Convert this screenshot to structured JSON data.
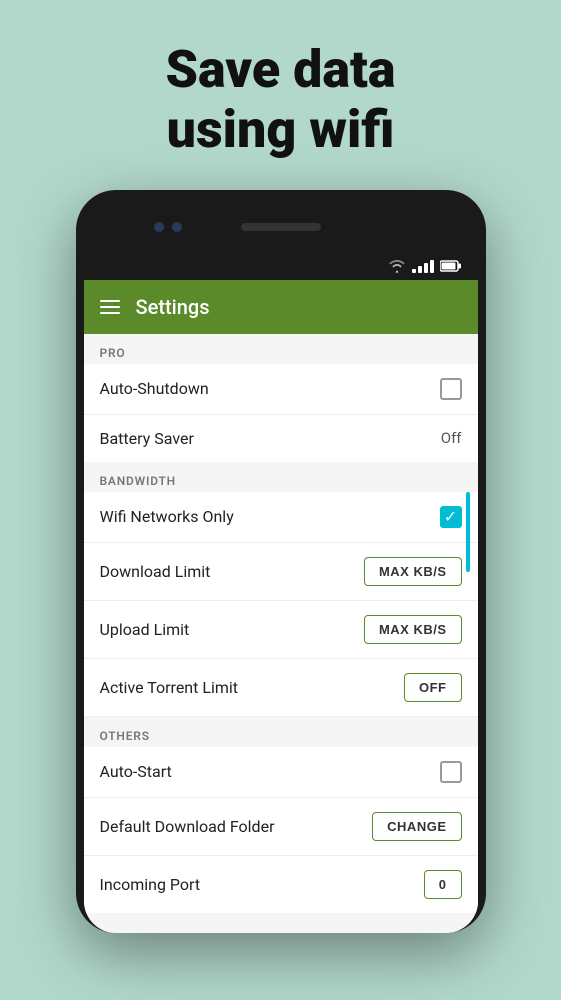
{
  "hero": {
    "title_line1": "Save data",
    "title_line2": "using wifi"
  },
  "appbar": {
    "title": "Settings",
    "menu_icon": "≡"
  },
  "status_bar": {
    "wifi": "wifi",
    "signal": "signal",
    "battery": "battery"
  },
  "sections": {
    "pro": {
      "header": "PRO",
      "rows": [
        {
          "label": "Auto-Shutdown",
          "control": "checkbox",
          "value": false
        },
        {
          "label": "Battery Saver",
          "control": "text",
          "value": "Off"
        }
      ]
    },
    "bandwidth": {
      "header": "BANDWIDTH",
      "rows": [
        {
          "label": "Wifi Networks Only",
          "control": "checkbox",
          "value": true
        },
        {
          "label": "Download Limit",
          "control": "button",
          "value": "MAX KB/S"
        },
        {
          "label": "Upload Limit",
          "control": "button",
          "value": "MAX KB/S"
        },
        {
          "label": "Active Torrent Limit",
          "control": "button",
          "value": "OFF"
        }
      ]
    },
    "others": {
      "header": "OTHERS",
      "rows": [
        {
          "label": "Auto-Start",
          "control": "checkbox",
          "value": false
        },
        {
          "label": "Default Download Folder",
          "control": "button",
          "value": "CHANGE"
        },
        {
          "label": "Incoming Port",
          "control": "button",
          "value": "0"
        }
      ]
    }
  }
}
